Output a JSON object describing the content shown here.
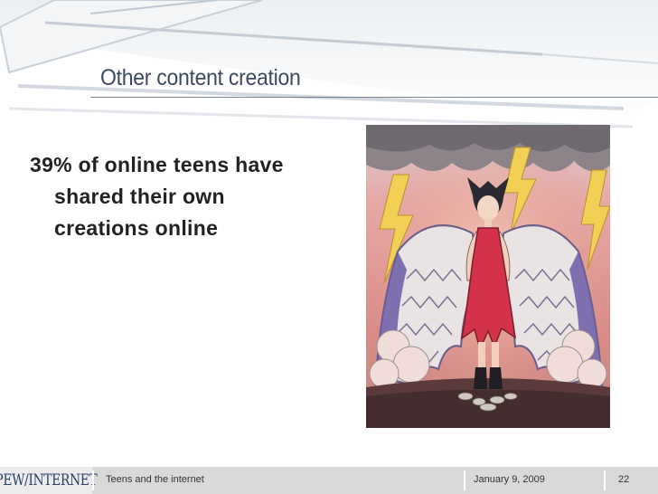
{
  "slide": {
    "title": "Other content creation",
    "bullet": "39% of online teens have shared their own creations online"
  },
  "image": {
    "name": "hand-drawn-winged-figure-illustration"
  },
  "footer": {
    "logo_text": "PEW/INTERNET",
    "presentation_title": "Teens and the internet",
    "date": "January 9, 2009",
    "page_number": "22"
  },
  "colors": {
    "title": "#3b4a5e",
    "body_text": "#222222",
    "footer_bar": "#d9d9d9",
    "logo": "#2b3f6b"
  }
}
